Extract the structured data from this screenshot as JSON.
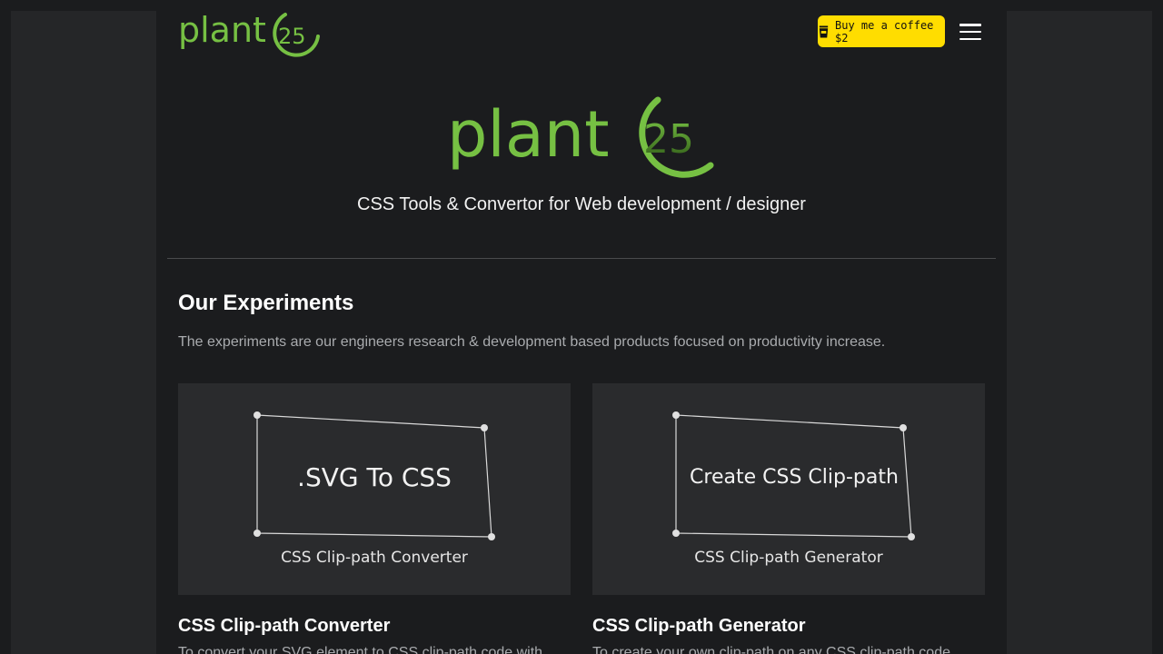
{
  "brand": {
    "logo_text": "plant",
    "logo_mark": "25",
    "color": "#76c043"
  },
  "header": {
    "coffee_label": "Buy me a coffee $2",
    "coffee_icon": "coffee-cup-icon",
    "menu_icon": "hamburger-menu-icon"
  },
  "hero": {
    "tagline": "CSS Tools & Convertor for Web development / designer"
  },
  "experiments": {
    "title": "Our Experiments",
    "description": "The experiments are our engineers research & development based products focused on productivity increase.",
    "cards": [
      {
        "preview_text": ".SVG To CSS",
        "preview_sub": "CSS Clip-path Converter",
        "title": "CSS Clip-path Converter",
        "text": "To convert your SVG element to CSS clip-path code with"
      },
      {
        "preview_text": "Create CSS Clip-path",
        "preview_sub": "CSS Clip-path Generator",
        "title": "CSS Clip-path Generator",
        "text": "To create your own clip-path on any CSS clip-path code"
      }
    ]
  }
}
